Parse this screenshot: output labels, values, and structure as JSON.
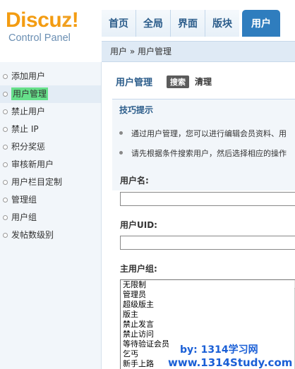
{
  "logo": {
    "main_part1": "Discu",
    "main_part2": "z",
    "main_bang": "!",
    "sub": "Control Panel"
  },
  "nav": {
    "tabs": [
      "首页",
      "全局",
      "界面",
      "版块",
      "用户"
    ],
    "active": "用户"
  },
  "breadcrumb": {
    "root": "用户",
    "sep": "»",
    "current": "用户管理"
  },
  "sidebar": {
    "items": [
      "添加用户",
      "用户管理",
      "禁止用户",
      "禁止 IP",
      "积分奖惩",
      "审核新用户",
      "用户栏目定制",
      "管理组",
      "用户组",
      "发帖数级别"
    ],
    "active": "用户管理"
  },
  "main": {
    "title": "用户管理",
    "search_button": "搜索",
    "clean_button": "清理",
    "tips_title": "技巧提示",
    "tips": [
      "通过用户管理，您可以进行编辑会员资料、用",
      "请先根据条件搜索用户，然后选择相应的操作"
    ],
    "username_label": "用户名:",
    "uid_label": "用户UID:",
    "group_label": "主用户组:",
    "groups": [
      "无限制",
      "管理员",
      "超级版主",
      "版主",
      "禁止发言",
      "禁止访问",
      "等待验证会员",
      "乞丐",
      "新手上路"
    ]
  },
  "watermark": {
    "line1": "by: 1314学习网",
    "line2": "www.1314Study.com"
  },
  "colors": {
    "accent": "#2f7dbe",
    "logo_orange": "#f39c12",
    "highlight": "#66e08a",
    "watermark": "#1a5fd6"
  }
}
